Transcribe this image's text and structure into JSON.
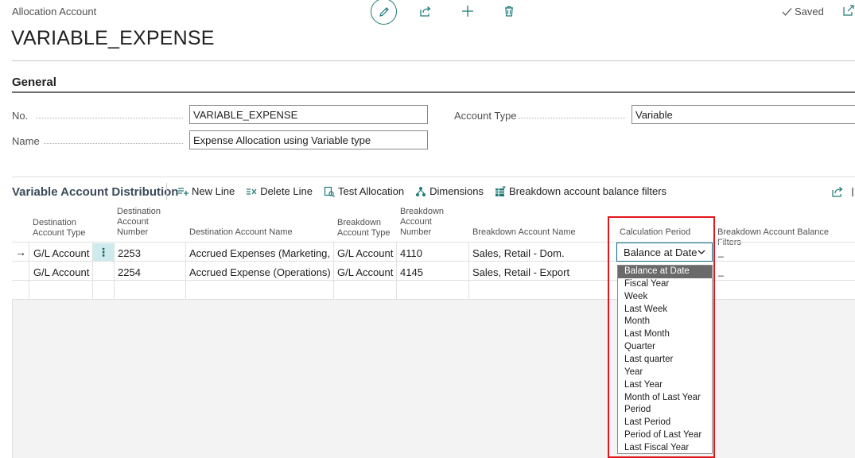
{
  "header": {
    "breadcrumb": "Allocation Account",
    "title": "VARIABLE_EXPENSE",
    "saved_label": "Saved"
  },
  "general": {
    "title": "General",
    "no_label": "No.",
    "no_value": "VARIABLE_EXPENSE",
    "name_label": "Name",
    "name_value": "Expense Allocation using Variable type",
    "account_type_label": "Account Type",
    "account_type_value": "Variable"
  },
  "distribution": {
    "title": "Variable Account Distribution",
    "actions": {
      "new_line": "New Line",
      "delete_line": "Delete Line",
      "test_allocation": "Test Allocation",
      "dimensions": "Dimensions",
      "breakdown_filters": "Breakdown account balance filters"
    },
    "columns": {
      "dest_type_1": "Destination",
      "dest_type_2": "Account Type",
      "dest_num_1": "Destination",
      "dest_num_2": "Account",
      "dest_num_3": "Number",
      "dest_name": "Destination Account Name",
      "bd_type_1": "Breakdown",
      "bd_type_2": "Account Type",
      "bd_num_1": "Breakdown",
      "bd_num_2": "Account",
      "bd_num_3": "Number",
      "bd_name": "Breakdown Account Name",
      "calc_period": "Calculation Period",
      "bd_filters": "Breakdown Account Balance Filters"
    },
    "rows": [
      {
        "dest_type": "G/L Account",
        "dest_number": "2253",
        "dest_name": "Accrued Expenses (Marketing, S...",
        "bd_type": "G/L Account",
        "bd_number": "4110",
        "bd_name": "Sales, Retail - Dom.",
        "calc_period": "Balance at Date",
        "filters": "_"
      },
      {
        "dest_type": "G/L Account",
        "dest_number": "2254",
        "dest_name": "Accrued Expense (Operations)",
        "bd_type": "G/L Account",
        "bd_number": "4145",
        "bd_name": "Sales, Retail - Export",
        "filters": "_"
      }
    ]
  },
  "calc_period_options": [
    "Balance at Date",
    "Fiscal Year",
    "Week",
    "Last Week",
    "Month",
    "Last Month",
    "Quarter",
    "Last quarter",
    "Year",
    "Last Year",
    "Month of Last Year",
    "Period",
    "Last Period",
    "Period of Last Year",
    "Last Fiscal Year"
  ],
  "colors": {
    "accent": "#1f7a78",
    "highlight": "#e2151d",
    "selected_option": "#6a6a6a",
    "row_menu": "#cdebed"
  }
}
